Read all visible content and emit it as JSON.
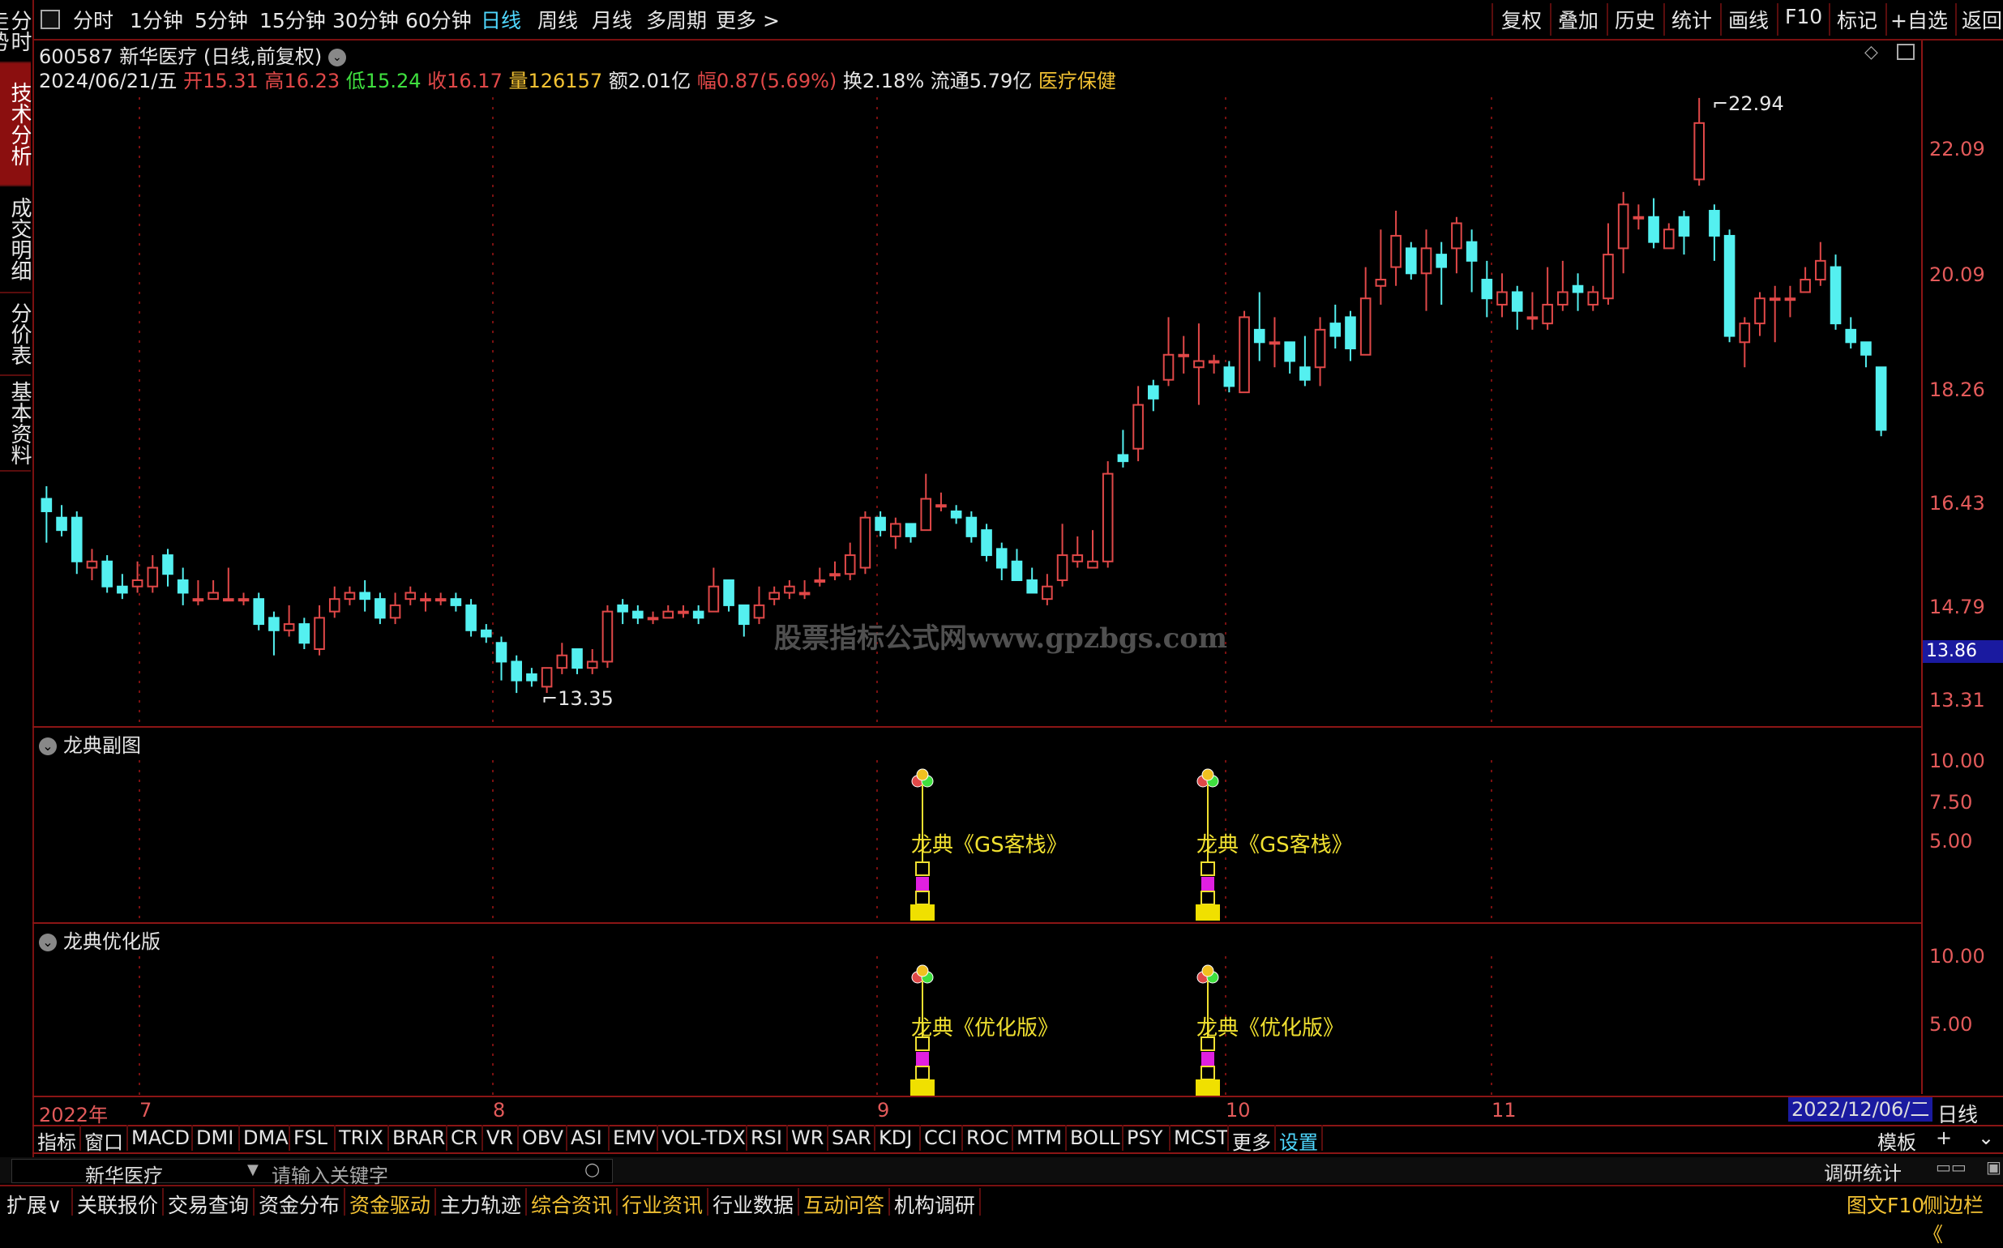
{
  "left_tabs": [
    {
      "label": "分时走势",
      "active": false
    },
    {
      "label": "技术分析",
      "active": true
    },
    {
      "label": "成交明细",
      "active": false
    },
    {
      "label": "分价表",
      "active": false
    },
    {
      "label": "基本资料",
      "active": false
    }
  ],
  "toolbar": {
    "periods": [
      "分时",
      "1分钟",
      "5分钟",
      "15分钟",
      "30分钟",
      "60分钟",
      "日线",
      "周线",
      "月线",
      "多周期",
      "更多 >"
    ],
    "active_period": "日线",
    "right_buttons": [
      "复权",
      "叠加",
      "历史",
      "统计",
      "画线",
      "F10",
      "标记",
      "+自选",
      "返回"
    ]
  },
  "quote": {
    "code_name": "600587 新华医疗 (日线,前复权)",
    "date": "2024/06/21/五",
    "open_label": "开",
    "open": "15.31",
    "high_label": "高",
    "high": "16.23",
    "low_label": "低",
    "low": "15.24",
    "close_label": "收",
    "close": "16.17",
    "vol_label": "量",
    "vol": "126157",
    "amount": "额2.01亿",
    "change_label": "幅",
    "change": "0.87(5.69%)",
    "turnover": "换2.18%",
    "float": "流通5.79亿",
    "sector": "医疗保健"
  },
  "main_chart": {
    "y_ticks": [
      "22.09",
      "20.09",
      "18.26",
      "16.43",
      "14.79",
      "13.31"
    ],
    "current_price_tag": "13.86",
    "high_annotation": "22.94",
    "low_annotation": "13.35",
    "watermark": "股票指标公式网www.gpzbgs.com"
  },
  "chart_data": {
    "type": "candlestick",
    "title": "600587 新华医疗 (日线,前复权)",
    "ylim": [
      13.0,
      23.3
    ],
    "y_ticks": [
      13.31,
      14.79,
      16.43,
      18.26,
      20.09,
      22.09
    ],
    "x_labels": [
      "2022年",
      "7",
      "8",
      "9",
      "10",
      "11"
    ],
    "candles": [
      [
        16.5,
        16.3,
        16.7,
        15.8
      ],
      [
        16.2,
        16.0,
        16.4,
        15.9
      ],
      [
        16.2,
        15.5,
        16.3,
        15.3
      ],
      [
        15.4,
        15.5,
        15.7,
        15.2
      ],
      [
        15.5,
        15.1,
        15.6,
        15.0
      ],
      [
        15.1,
        15.0,
        15.3,
        14.9
      ],
      [
        15.1,
        15.2,
        15.5,
        15.0
      ],
      [
        15.1,
        15.4,
        15.6,
        15.0
      ],
      [
        15.6,
        15.3,
        15.7,
        15.1
      ],
      [
        15.2,
        15.0,
        15.4,
        14.8
      ],
      [
        14.9,
        14.9,
        15.2,
        14.8
      ],
      [
        14.9,
        15.0,
        15.2,
        14.9
      ],
      [
        14.9,
        14.9,
        15.4,
        14.9
      ],
      [
        14.9,
        14.9,
        15.0,
        14.8
      ],
      [
        14.9,
        14.5,
        15.0,
        14.4
      ],
      [
        14.6,
        14.4,
        14.7,
        14.0
      ],
      [
        14.4,
        14.5,
        14.8,
        14.3
      ],
      [
        14.5,
        14.2,
        14.6,
        14.1
      ],
      [
        14.1,
        14.6,
        14.8,
        14.0
      ],
      [
        14.7,
        14.9,
        15.1,
        14.6
      ],
      [
        14.9,
        15.0,
        15.1,
        14.8
      ],
      [
        15.0,
        14.9,
        15.2,
        14.7
      ],
      [
        14.9,
        14.6,
        15.0,
        14.5
      ],
      [
        14.6,
        14.8,
        15.0,
        14.5
      ],
      [
        14.9,
        15.0,
        15.1,
        14.8
      ],
      [
        14.9,
        14.9,
        15.0,
        14.7
      ],
      [
        14.9,
        14.9,
        15.0,
        14.8
      ],
      [
        14.9,
        14.8,
        15.0,
        14.7
      ],
      [
        14.8,
        14.4,
        14.9,
        14.3
      ],
      [
        14.4,
        14.3,
        14.5,
        14.2
      ],
      [
        14.2,
        13.9,
        14.3,
        13.6
      ],
      [
        13.9,
        13.6,
        14.0,
        13.4
      ],
      [
        13.7,
        13.6,
        13.8,
        13.5
      ],
      [
        13.5,
        13.8,
        13.8,
        13.4
      ],
      [
        13.8,
        14.0,
        14.2,
        13.7
      ],
      [
        14.1,
        13.8,
        14.1,
        13.7
      ],
      [
        13.8,
        13.9,
        14.1,
        13.7
      ],
      [
        13.9,
        14.7,
        14.8,
        13.8
      ],
      [
        14.8,
        14.7,
        14.9,
        14.5
      ],
      [
        14.7,
        14.6,
        14.8,
        14.5
      ],
      [
        14.6,
        14.6,
        14.7,
        14.5
      ],
      [
        14.6,
        14.7,
        14.8,
        14.6
      ],
      [
        14.7,
        14.7,
        14.8,
        14.6
      ],
      [
        14.7,
        14.6,
        14.8,
        14.5
      ],
      [
        14.7,
        15.1,
        15.4,
        14.7
      ],
      [
        15.2,
        14.8,
        15.2,
        14.7
      ],
      [
        14.8,
        14.5,
        14.8,
        14.3
      ],
      [
        14.6,
        14.8,
        15.1,
        14.5
      ],
      [
        14.9,
        15.0,
        15.1,
        14.8
      ],
      [
        15.0,
        15.1,
        15.2,
        14.9
      ],
      [
        15.0,
        15.0,
        15.2,
        14.9
      ],
      [
        15.2,
        15.2,
        15.4,
        15.1
      ],
      [
        15.3,
        15.3,
        15.5,
        15.2
      ],
      [
        15.3,
        15.6,
        15.8,
        15.2
      ],
      [
        15.4,
        16.2,
        16.3,
        15.3
      ],
      [
        16.2,
        16.0,
        16.3,
        15.9
      ],
      [
        15.9,
        16.1,
        16.2,
        15.7
      ],
      [
        16.1,
        15.9,
        16.1,
        15.8
      ],
      [
        16.0,
        16.5,
        16.9,
        16.0
      ],
      [
        16.4,
        16.4,
        16.6,
        16.3
      ],
      [
        16.3,
        16.2,
        16.4,
        16.1
      ],
      [
        16.2,
        15.9,
        16.3,
        15.8
      ],
      [
        16.0,
        15.6,
        16.1,
        15.5
      ],
      [
        15.7,
        15.4,
        15.8,
        15.2
      ],
      [
        15.5,
        15.2,
        15.7,
        15.2
      ],
      [
        15.2,
        15.0,
        15.4,
        15.0
      ],
      [
        14.9,
        15.1,
        15.3,
        14.8
      ],
      [
        15.2,
        15.6,
        16.1,
        15.1
      ],
      [
        15.5,
        15.6,
        15.9,
        15.4
      ],
      [
        15.4,
        15.5,
        16.0,
        15.4
      ],
      [
        15.5,
        16.9,
        17.1,
        15.4
      ],
      [
        17.2,
        17.1,
        17.6,
        17.0
      ],
      [
        17.3,
        18.0,
        18.3,
        17.1
      ],
      [
        18.3,
        18.1,
        18.4,
        17.9
      ],
      [
        18.4,
        18.8,
        19.4,
        18.3
      ],
      [
        18.8,
        18.8,
        19.1,
        18.5
      ],
      [
        18.6,
        18.7,
        19.3,
        18.0
      ],
      [
        18.7,
        18.7,
        18.8,
        18.5
      ],
      [
        18.6,
        18.3,
        18.7,
        18.2
      ],
      [
        18.2,
        19.4,
        19.5,
        18.2
      ],
      [
        19.2,
        19.0,
        19.8,
        18.7
      ],
      [
        19.0,
        19.0,
        19.4,
        18.6
      ],
      [
        19.0,
        18.7,
        19.0,
        18.5
      ],
      [
        18.6,
        18.4,
        19.1,
        18.3
      ],
      [
        18.6,
        19.2,
        19.4,
        18.3
      ],
      [
        19.3,
        19.1,
        19.6,
        18.9
      ],
      [
        19.4,
        18.9,
        19.5,
        18.7
      ],
      [
        18.8,
        19.7,
        20.2,
        18.8
      ],
      [
        19.9,
        20.0,
        20.8,
        19.6
      ],
      [
        20.2,
        20.7,
        21.1,
        19.9
      ],
      [
        20.5,
        20.1,
        20.6,
        20.0
      ],
      [
        20.1,
        20.5,
        20.8,
        19.5
      ],
      [
        20.4,
        20.2,
        20.6,
        19.6
      ],
      [
        20.5,
        20.9,
        21.0,
        20.1
      ],
      [
        20.6,
        20.3,
        20.8,
        19.8
      ],
      [
        20.0,
        19.7,
        20.3,
        19.4
      ],
      [
        19.6,
        19.8,
        20.1,
        19.4
      ],
      [
        19.8,
        19.5,
        19.9,
        19.2
      ],
      [
        19.4,
        19.4,
        19.8,
        19.2
      ],
      [
        19.3,
        19.6,
        20.2,
        19.2
      ],
      [
        19.6,
        19.8,
        20.3,
        19.5
      ],
      [
        19.9,
        19.8,
        20.1,
        19.5
      ],
      [
        19.6,
        19.8,
        19.9,
        19.5
      ],
      [
        19.7,
        20.4,
        20.9,
        19.6
      ],
      [
        20.5,
        21.2,
        21.4,
        20.1
      ],
      [
        21.0,
        21.0,
        21.2,
        20.8
      ],
      [
        21.0,
        20.6,
        21.3,
        20.5
      ],
      [
        20.5,
        20.8,
        20.9,
        20.5
      ],
      [
        21.0,
        20.7,
        21.1,
        20.4
      ],
      [
        21.6,
        22.5,
        22.9,
        21.5
      ],
      [
        21.1,
        20.7,
        21.2,
        20.3
      ],
      [
        20.7,
        19.1,
        20.8,
        19.0
      ],
      [
        19.0,
        19.3,
        19.4,
        18.6
      ],
      [
        19.3,
        19.7,
        19.8,
        19.1
      ],
      [
        19.7,
        19.7,
        19.9,
        19.0
      ],
      [
        19.7,
        19.7,
        19.9,
        19.4
      ],
      [
        19.8,
        20.0,
        20.2,
        19.8
      ],
      [
        20.0,
        20.3,
        20.6,
        19.9
      ],
      [
        20.2,
        19.3,
        20.4,
        19.2
      ],
      [
        19.2,
        19.0,
        19.4,
        18.9
      ],
      [
        19.0,
        18.8,
        19.0,
        18.6
      ],
      [
        18.6,
        17.6,
        18.6,
        17.5
      ]
    ],
    "high_marker": 22.94,
    "low_marker": 13.35
  },
  "panels": [
    {
      "title": "龙典副图",
      "y_ticks": [
        "10.00",
        "7.50",
        "5.00"
      ],
      "signal_label": "龙典《GS客栈》"
    },
    {
      "title": "龙典优化版",
      "y_ticks": [
        "10.00",
        "5.00"
      ],
      "signal_label": "龙典《优化版》"
    }
  ],
  "date_row": {
    "labels": [
      "2022年",
      "7",
      "8",
      "9",
      "10",
      "11"
    ],
    "cursor_date": "2022/12/06/二",
    "period_label": "日线"
  },
  "indicator_tabs": [
    "指标",
    "窗口",
    "MACD",
    "DMI",
    "DMA",
    "FSL",
    "TRIX",
    "BRAR",
    "CR",
    "VR",
    "OBV",
    "ASI",
    "EMV",
    "VOL-TDX",
    "RSI",
    "WR",
    "SAR",
    "KDJ",
    "CCI",
    "ROC",
    "MTM",
    "BOLL",
    "PSY",
    "MCST",
    "更多",
    "设置"
  ],
  "indicator_right": {
    "template": "模板",
    "plus": "+"
  },
  "search_row": {
    "stock_name": "新华医疗",
    "placeholder": "请输入关键字",
    "research": "调研统计"
  },
  "bottom_nav": {
    "items": [
      "扩展∨",
      "关联报价",
      "交易查询",
      "资金分布",
      "资金驱动",
      "主力轨迹",
      "综合资讯",
      "行业资讯",
      "行业数据",
      "互动问答",
      "机构调研"
    ],
    "gold_items": [
      "资金驱动",
      "综合资讯",
      "行业资讯",
      "互动问答"
    ],
    "right": [
      "图文F10",
      "侧边栏《"
    ]
  },
  "colors": {
    "up": "#e04848",
    "down": "#54f0f0",
    "border": "#8b1515",
    "accent_blue": "#4fd8ff",
    "signal_yellow": "#f0e030"
  }
}
